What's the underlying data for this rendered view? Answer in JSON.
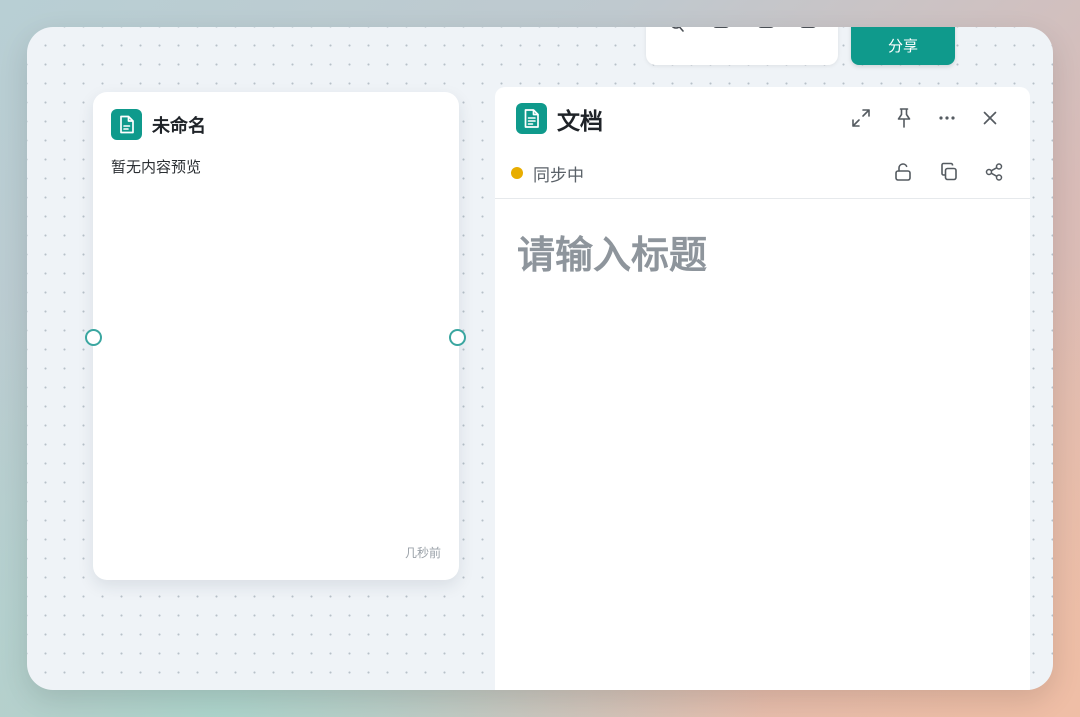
{
  "toolbar": {
    "share_label": "分享"
  },
  "card": {
    "title": "未命名",
    "preview": "暂无内容预览",
    "time": "几秒前"
  },
  "panel": {
    "title": "文档",
    "status": "同步中",
    "title_placeholder": "请输入标题"
  },
  "colors": {
    "accent": "#0f9a8c",
    "status_syncing": "#e8ad00",
    "handle": "#3aa6a0"
  },
  "icons": {
    "card_icon": "document-icon",
    "panel_icon": "document-icon",
    "expand": "expand-icon",
    "pin": "pin-icon",
    "more": "more-icon",
    "close": "close-icon",
    "lock": "unlock-icon",
    "copy": "copy-icon",
    "share": "share-icon"
  }
}
